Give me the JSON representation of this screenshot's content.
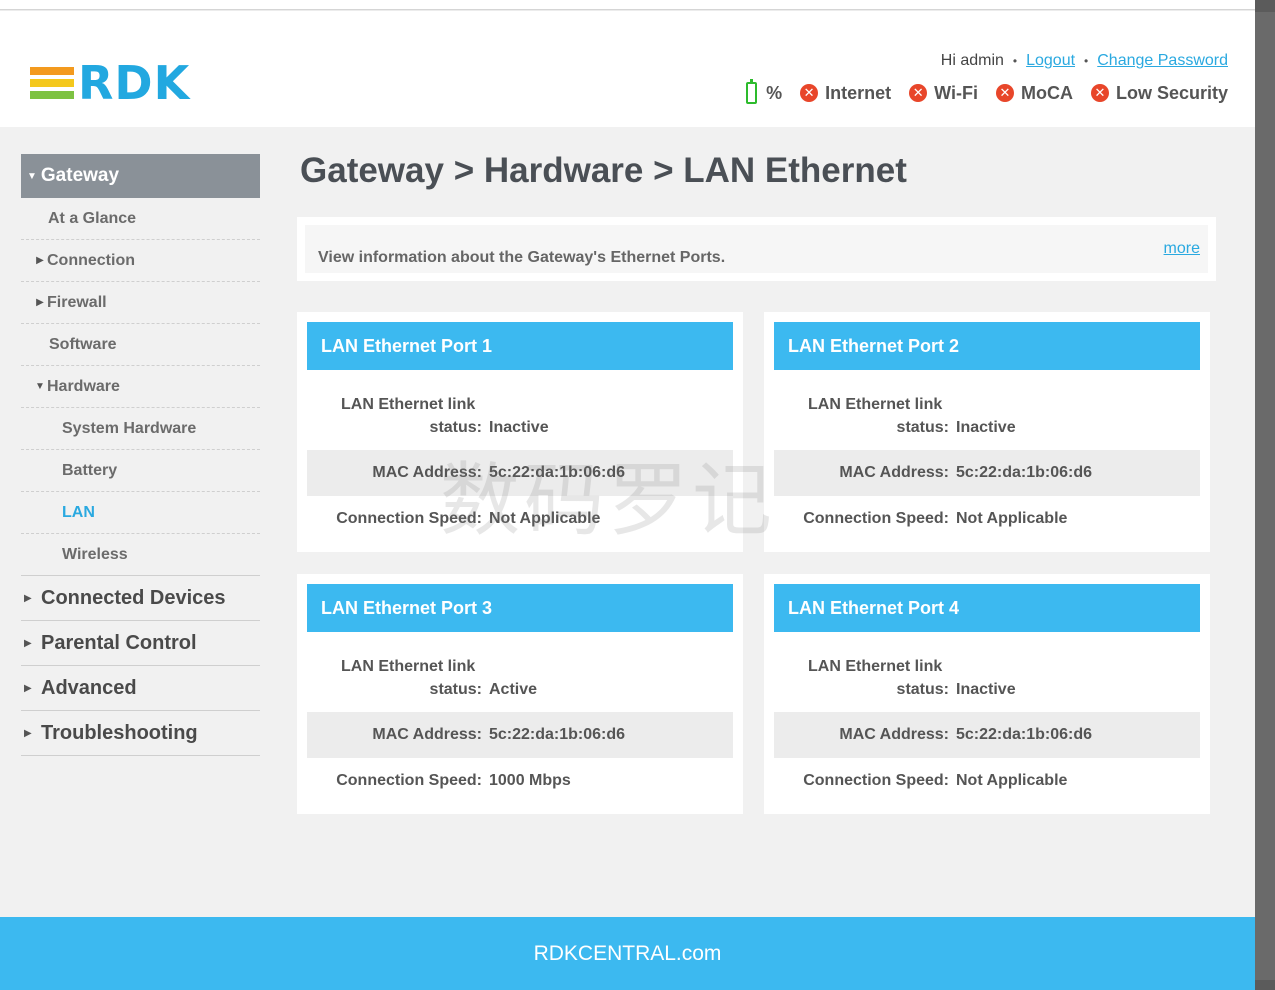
{
  "header": {
    "logo_text": "RDK",
    "user": {
      "greeting": "Hi admin",
      "logout": "Logout",
      "change_password": "Change Password"
    },
    "status": {
      "battery": "%",
      "internet": "Internet",
      "wifi": "Wi-Fi",
      "moca": "MoCA",
      "security": "Low Security"
    }
  },
  "sidebar": {
    "gateway": "Gateway",
    "at_a_glance": "At a Glance",
    "connection": "Connection",
    "firewall": "Firewall",
    "software": "Software",
    "hardware": "Hardware",
    "system_hardware": "System Hardware",
    "battery": "Battery",
    "lan": "LAN",
    "wireless": "Wireless",
    "connected_devices": "Connected Devices",
    "parental_control": "Parental Control",
    "advanced": "Advanced",
    "troubleshooting": "Troubleshooting"
  },
  "main": {
    "title": "Gateway > Hardware > LAN Ethernet",
    "intro": "View information about the Gateway's Ethernet Ports.",
    "more": "more",
    "labels": {
      "link_line1": "LAN Ethernet link",
      "link_line2": "status:",
      "mac": "MAC Address:",
      "speed": "Connection Speed:"
    },
    "ports": [
      {
        "title": "LAN Ethernet Port 1",
        "status": "Inactive",
        "mac": "5c:22:da:1b:06:d6",
        "speed": "Not Applicable"
      },
      {
        "title": "LAN Ethernet Port 2",
        "status": "Inactive",
        "mac": "5c:22:da:1b:06:d6",
        "speed": "Not Applicable"
      },
      {
        "title": "LAN Ethernet Port 3",
        "status": "Active",
        "mac": "5c:22:da:1b:06:d6",
        "speed": "1000 Mbps"
      },
      {
        "title": "LAN Ethernet Port 4",
        "status": "Inactive",
        "mac": "5c:22:da:1b:06:d6",
        "speed": "Not Applicable"
      }
    ]
  },
  "footer": {
    "text": "RDKCENTRAL.com"
  },
  "watermark": "数码罗记",
  "colors": {
    "accent": "#3cb9f0",
    "link": "#2aa9e0",
    "nav_header": "#8a9198",
    "error": "#e8462a",
    "battery": "#2dbb2d",
    "logo_orange": "#f39a1e",
    "logo_yellow": "#f4c81c",
    "logo_green": "#7dc242"
  }
}
